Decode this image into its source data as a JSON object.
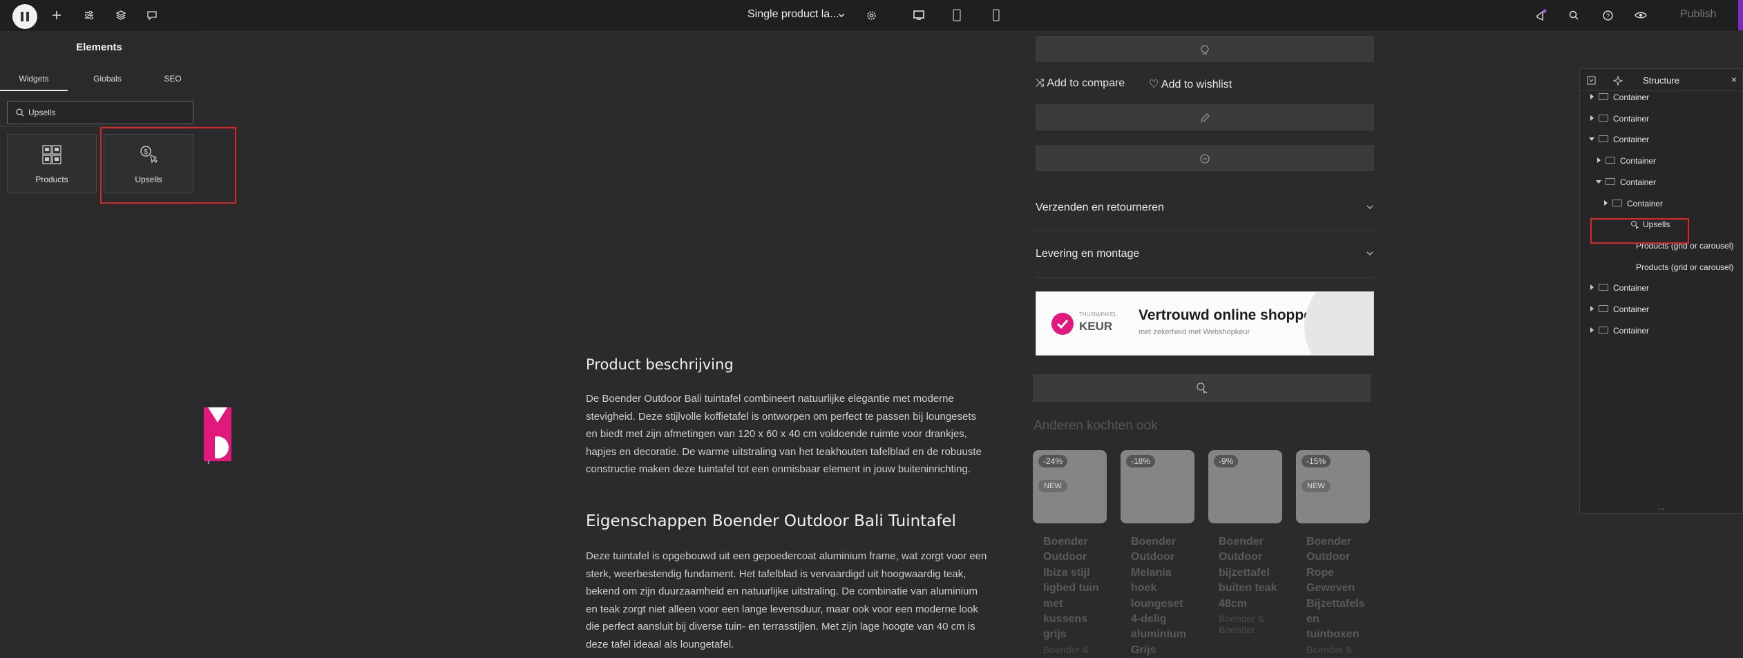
{
  "topbar": {
    "document_title": "Single product la...",
    "publish_label": "Publish",
    "icons": [
      "elementor-logo-icon",
      "add-icon",
      "settings-sliders-icon",
      "layers-icon",
      "comments-icon",
      "chevron-down-icon",
      "gear-icon",
      "desktop-icon",
      "tablet-icon",
      "mobile-icon",
      "whats-new-icon",
      "search-icon",
      "help-icon",
      "preview-eye-icon"
    ]
  },
  "panel": {
    "title": "Elements",
    "tabs": [
      {
        "label": "Widgets",
        "active": true
      },
      {
        "label": "Globals",
        "active": false
      },
      {
        "label": "SEO",
        "active": false
      }
    ],
    "search_value": "Upsells",
    "widgets": [
      {
        "label": "Products",
        "icon": "products-grid-icon"
      },
      {
        "label": "Upsells",
        "icon": "upsells-icon",
        "highlighted": true
      }
    ]
  },
  "canvas": {
    "actions": {
      "compare": "Add to compare",
      "wishlist": "Add to wishlist"
    },
    "accordion": [
      {
        "title": "Verzenden en retourneren"
      },
      {
        "title": "Levering en montage"
      }
    ],
    "keur": {
      "brand_small": "THUISWINKEL",
      "brand": "KEUR",
      "headline": "Vertrouwd online shoppen",
      "sub": "met zekerheid met Webshopkeur"
    },
    "description_heading": "Product beschrijving",
    "description_text": "De Boender Outdoor Bali tuintafel combineert natuurlijke elegantie met moderne stevigheid. Deze stijlvolle koffietafel is ontworpen om perfect te passen bij loungesets en biedt met zijn afmetingen van 120 x 60 x 40 cm voldoende ruimte voor drankjes, hapjes en decoratie. De warme uitstraling van het teakhouten tafelblad en de robuuste constructie maken deze tuintafel tot een onmisbaar element in jouw buiteninrichting.",
    "properties_heading": "Eigenschappen Boender Outdoor Bali Tuintafel",
    "properties_text": "Deze tuintafel is opgebouwd uit een gepoedercoat aluminium frame, wat zorgt voor een sterk, weerbestendig fundament. Het tafelblad is vervaardigd uit hoogwaardig teak, bekend om zijn duurzaamheid en natuurlijke uitstraling. De combinatie van aluminium en teak zorgt niet alleen voor een lange levensduur, maar ook voor een moderne look die perfect aansluit bij diverse tuin- en terrasstijlen. Met zijn lage hoogte van 40 cm is deze tafel ideaal als loungetafel.",
    "related_heading": "Anderen kochten ook",
    "products": [
      {
        "discount": "-24%",
        "badge": "NEW",
        "name": "Boender Outdoor Ibiza stijl ligbed tuin met kussens grijs",
        "brand": "Boender &"
      },
      {
        "discount": "-18%",
        "badge": "",
        "name": "Boender Outdoor Melania hoek loungeset 4-delig aluminium Grijs",
        "brand": ""
      },
      {
        "discount": "-9%",
        "badge": "",
        "name": "Boender Outdoor bijzettafel buiten teak 48cm",
        "brand": "Boender & Boender"
      },
      {
        "discount": "-15%",
        "badge": "NEW",
        "name": "Boender Outdoor Rope Geweven Bijzettafels en tuinboxen",
        "brand": "Boender &"
      }
    ]
  },
  "structure": {
    "title": "Structure",
    "items": [
      {
        "label": "Container",
        "depth": 0,
        "expanded": false
      },
      {
        "label": "Container",
        "depth": 0,
        "expanded": false
      },
      {
        "label": "Container",
        "depth": 0,
        "expanded": true
      },
      {
        "label": "Container",
        "depth": 1,
        "expanded": false
      },
      {
        "label": "Container",
        "depth": 1,
        "expanded": true
      },
      {
        "label": "Container",
        "depth": 2,
        "expanded": false
      },
      {
        "label": "Upsells",
        "depth": 2,
        "highlighted": true
      },
      {
        "label": "Products (grid or carousel)",
        "depth": 2
      },
      {
        "label": "Products (grid or carousel)",
        "depth": 2
      },
      {
        "label": "Container",
        "depth": 0,
        "expanded": false
      },
      {
        "label": "Container",
        "depth": 0,
        "expanded": false
      },
      {
        "label": "Container",
        "depth": 0,
        "expanded": false
      }
    ],
    "footer": "..."
  },
  "colors": {
    "highlight": "#e02424",
    "accent_pink": "#e2197d",
    "purple": "#7b2cbf"
  }
}
